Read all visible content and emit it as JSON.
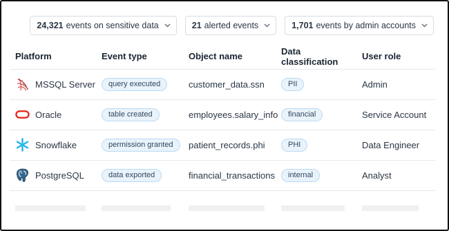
{
  "filters": [
    {
      "count": "24,321",
      "label": "events on sensitive data"
    },
    {
      "count": "21",
      "label": "alerted events"
    },
    {
      "count": "1,701",
      "label": "events by admin accounts"
    }
  ],
  "table": {
    "headers": {
      "platform": "Platform",
      "event_type": "Event type",
      "object_name": "Object name",
      "data_classification": "Data classification",
      "user_role": "User role"
    },
    "rows": [
      {
        "platform": "MSSQL Server",
        "platform_icon": "mssql-server-icon",
        "event_type": "query executed",
        "object_name": "customer_data.ssn",
        "classification": "PII",
        "user_role": "Admin"
      },
      {
        "platform": "Oracle",
        "platform_icon": "oracle-icon",
        "event_type": "table created",
        "object_name": "employees.salary_info",
        "classification": "financial",
        "user_role": "Service Account"
      },
      {
        "platform": "Snowflake",
        "platform_icon": "snowflake-icon",
        "event_type": "permission granted",
        "object_name": "patient_records.phi",
        "classification": "PHI",
        "user_role": "Data Engineer"
      },
      {
        "platform": "PostgreSQL",
        "platform_icon": "postgresql-icon",
        "event_type": "data exported",
        "object_name": "financial_transactions",
        "classification": "internal",
        "user_role": "Analyst"
      }
    ]
  },
  "colors": {
    "badge_bg": "#e8f3fc",
    "badge_border": "#bcdaf2",
    "oracle_red": "#e2231a",
    "snowflake_blue": "#29b5e8",
    "mssql_red": "#cc2927"
  }
}
